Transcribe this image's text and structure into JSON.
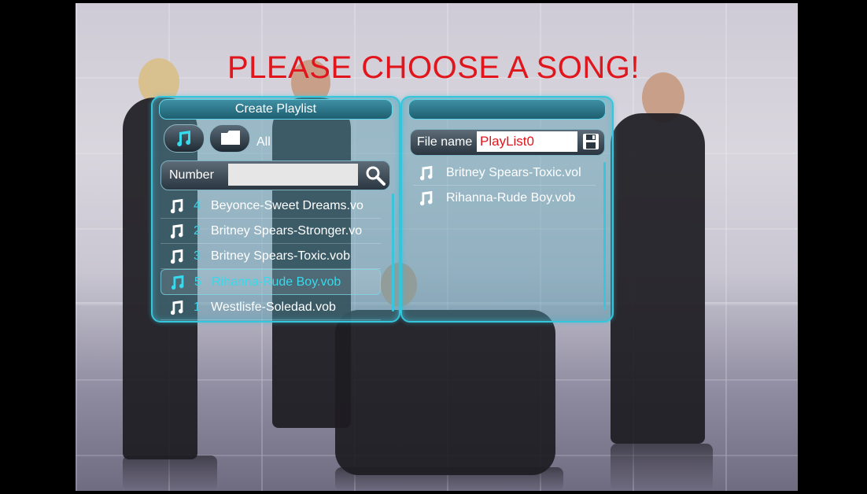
{
  "title": "PLEASE CHOOSE A SONG!",
  "left_panel": {
    "header": "Create Playlist",
    "tabs": [
      {
        "icon": "music-note-icon"
      },
      {
        "icon": "folder-icon"
      }
    ],
    "filter_label": "All",
    "number_label": "Number",
    "number_value": "",
    "songs": [
      {
        "num": "4",
        "name": "Beyonce-Sweet Dreams.vo"
      },
      {
        "num": "2",
        "name": "Britney Spears-Stronger.vo"
      },
      {
        "num": "3",
        "name": "Britney Spears-Toxic.vob"
      },
      {
        "num": "5",
        "name": "Rihanna-Rude Boy.vob"
      },
      {
        "num": "1",
        "name": "Westlisfe-Soledad.vob"
      }
    ],
    "selected_index": 3
  },
  "right_panel": {
    "header": "",
    "file_name_label": "File name",
    "file_name_value": "PlayList0",
    "playlist": [
      {
        "name": "Britney Spears-Toxic.vol"
      },
      {
        "name": "Rihanna-Rude Boy.vob"
      }
    ]
  },
  "colors": {
    "title": "#e0161c",
    "accent": "#35c6de",
    "selected_text": "#37d9ec"
  }
}
